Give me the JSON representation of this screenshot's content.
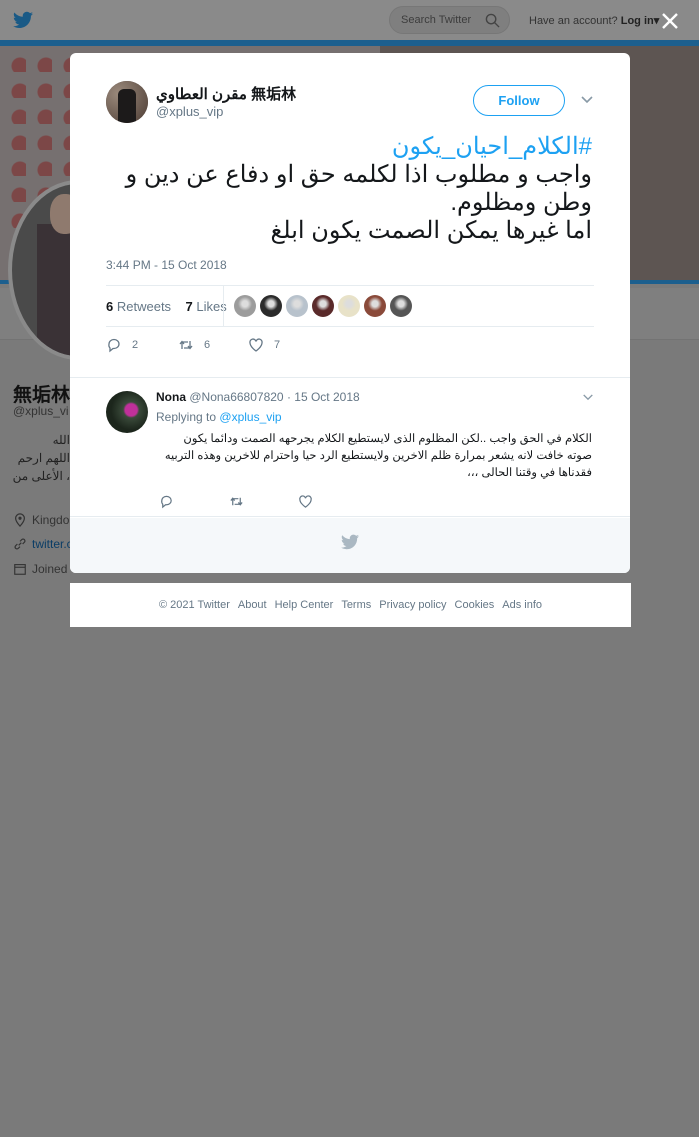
{
  "header": {
    "search_placeholder": "Search Twitter",
    "have_account": "Have an account?",
    "login_label": "Log in"
  },
  "profile_bg": {
    "name": "無垢林",
    "handle": "@xplus_vi",
    "bio_lines": [
      "الله",
      "اللهم ارحم",
      "، الأعلى من"
    ],
    "location": "Kingdo",
    "link": "twitter.c",
    "joined": "Joined"
  },
  "tweet": {
    "author_name": "مقرن العطاوي 無垢林",
    "author_handle": "@xplus_vip",
    "follow_label": "Follow",
    "hashtag": "#الكلام_احيان_يكون",
    "body": "واجب و مطلوب اذا لكلمه حق او دفاع عن دين و وطن ومظلوم.\nاما غيرها يمكن الصمت يكون ابلغ",
    "timestamp": "3:44 PM - 15 Oct 2018",
    "retweets_count": "6",
    "retweets_label": "Retweets",
    "likes_count": "7",
    "likes_label": "Likes",
    "reply_count": "2",
    "retweet_action_count": "6",
    "like_action_count": "7",
    "liker_colors": [
      "#9c9c9c",
      "#2b2b2b",
      "#b8c2cc",
      "#5a2a2a",
      "#e8e2c8",
      "#8a4a3a",
      "#555555"
    ]
  },
  "reply": {
    "name": "Nona",
    "handle": "@Nona66807820",
    "date": "· 15 Oct 2018",
    "replying_prefix": "Replying to",
    "replying_to": "@xplus_vip",
    "text": "الكلام في الحق واجب ..لكن المظلوم الذى لايستطيع الكلام يجرحهه الصمت ودائما يكون صوته خافت لانه يشعر بمرارة ظلم الاخرين ولايستطيع الرد حيا واحترام للاخرين وهذه التربيه فقدناها في وقتنا الحالى ،،،"
  },
  "footer": {
    "copyright": "© 2021 Twitter",
    "links": [
      "About",
      "Help Center",
      "Terms",
      "Privacy policy",
      "Cookies",
      "Ads info"
    ]
  },
  "colors": {
    "accent": "#1da1f2",
    "overlay_gray": "#7a7a7a"
  }
}
